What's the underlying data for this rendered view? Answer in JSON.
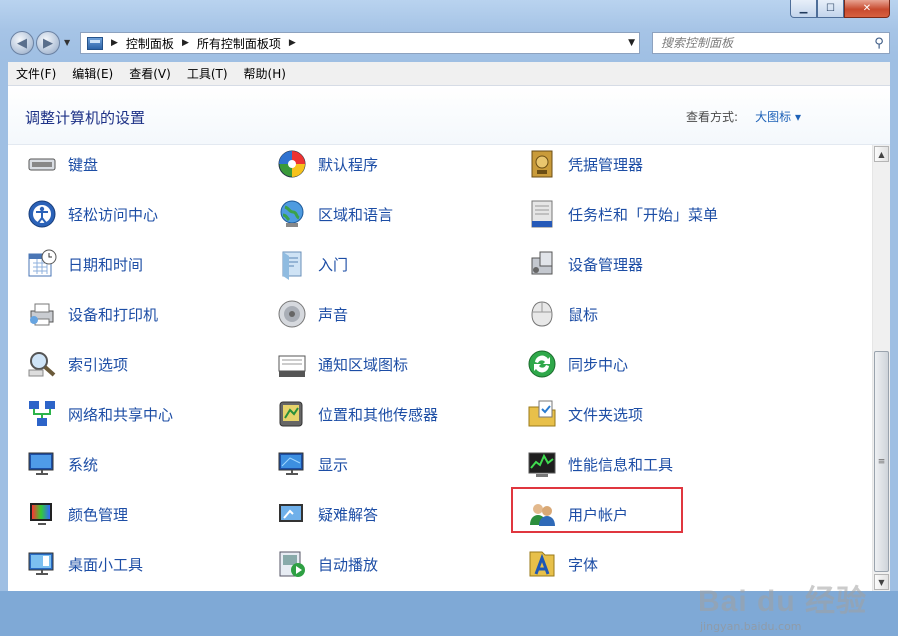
{
  "titlebar": {
    "minimize": "▁",
    "maximize": "☐",
    "close": "✕"
  },
  "nav": {
    "back_icon": "back-arrow-icon",
    "forward_icon": "forward-arrow-icon",
    "breadcrumb": [
      "控制面板",
      "所有控制面板项"
    ],
    "search_placeholder": "搜索控制面板"
  },
  "menubar": [
    "文件(F)",
    "编辑(E)",
    "查看(V)",
    "工具(T)",
    "帮助(H)"
  ],
  "header": {
    "title": "调整计算机的设置",
    "view_label": "查看方式:",
    "view_value": "大图标 ▾"
  },
  "columns": [
    [
      "键盘",
      "轻松访问中心",
      "日期和时间",
      "设备和打印机",
      "索引选项",
      "网络和共享中心",
      "系统",
      "颜色管理",
      "桌面小工具"
    ],
    [
      "默认程序",
      "区域和语言",
      "入门",
      "声音",
      "通知区域图标",
      "位置和其他传感器",
      "显示",
      "疑难解答",
      "自动播放"
    ],
    [
      "凭据管理器",
      "任务栏和「开始」菜单",
      "设备管理器",
      "鼠标",
      "同步中心",
      "文件夹选项",
      "性能信息和工具",
      "用户帐户",
      "字体"
    ]
  ],
  "highlighted_item": "用户帐户",
  "watermark": {
    "text": "Bai du 经验",
    "url": "jingyan.baidu.com"
  },
  "colors": {
    "link": "#1c4da5",
    "title": "#1e3287",
    "highlight_border": "#e0363f"
  }
}
